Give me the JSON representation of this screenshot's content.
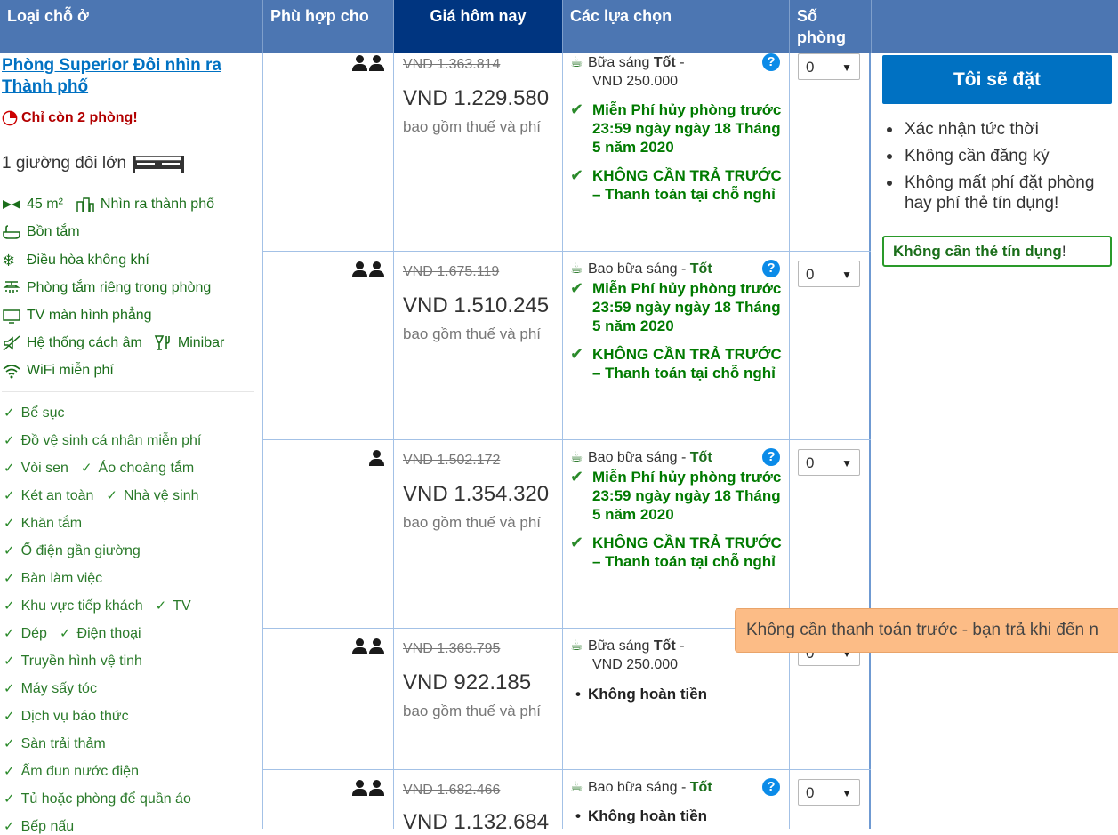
{
  "header": {
    "col_room_type": "Loại chỗ ở",
    "col_fits": "Phù hợp cho",
    "col_price": "Giá hôm nay",
    "col_options": "Các lựa chọn",
    "col_rooms": "Số phòng"
  },
  "room": {
    "name": "Phòng Superior Đôi nhìn ra Thành phố",
    "scarcity": "Chỉ còn 2 phòng!",
    "bed": "1 giường đôi lớn",
    "facilities": {
      "size": "45 m²",
      "view": "Nhìn ra thành phố",
      "bathtub": "Bồn tắm",
      "ac": "Điều hòa không khí",
      "private_bath": "Phòng tắm riêng trong phòng",
      "tv": "TV màn hình phẳng",
      "soundproof": "Hệ thống cách âm",
      "minibar": "Minibar",
      "wifi": "WiFi miễn phí"
    },
    "amenities": [
      [
        "Bể sục"
      ],
      [
        "Đồ vệ sinh cá nhân miễn phí"
      ],
      [
        "Vòi sen",
        "Áo choàng tắm"
      ],
      [
        "Két an toàn",
        "Nhà vệ sinh"
      ],
      [
        "Khăn tắm"
      ],
      [
        "Ổ điện gần giường"
      ],
      [
        "Bàn làm việc"
      ],
      [
        "Khu vực tiếp khách",
        "TV"
      ],
      [
        "Dép",
        "Điện thoại"
      ],
      [
        "Truyền hình vệ tinh"
      ],
      [
        "Máy sấy tóc"
      ],
      [
        "Dịch vụ báo thức"
      ],
      [
        "Sàn trải thảm"
      ],
      [
        "Ấm đun nước điện"
      ],
      [
        "Tủ hoặc phòng để quần áo"
      ],
      [
        "Bếp nấu"
      ]
    ]
  },
  "common": {
    "price_note": "bao gồm thuế và phí",
    "cancel": "Miễn Phí hủy phòng trước 23:59 ngày ngày 18 Tháng 5 năm 2020",
    "no_prepay": "KHÔNG CẦN TRẢ TRƯỚC – Thanh toán tại chỗ nghỉ",
    "non_refundable": "Không hoàn tiền",
    "qty_value": "0"
  },
  "rows": [
    {
      "guests": 2,
      "old_price": "VND 1.363.814",
      "new_price": "VND 1.229.580",
      "bf_label": "Bữa sáng",
      "bf_quality": "Tốt",
      "bf_price": "VND 250.000"
    },
    {
      "guests": 2,
      "old_price": "VND 1.675.119",
      "new_price": "VND 1.510.245",
      "bf_label": "Bao bữa sáng",
      "bf_quality": "Tốt"
    },
    {
      "guests": 1,
      "old_price": "VND 1.502.172",
      "new_price": "VND 1.354.320",
      "bf_label": "Bao bữa sáng",
      "bf_quality": "Tốt"
    },
    {
      "guests": 2,
      "old_price": "VND 1.369.795",
      "new_price": "VND 922.185",
      "bf_label": "Bữa sáng",
      "bf_quality": "Tốt",
      "bf_price": "VND 250.000"
    },
    {
      "guests": 2,
      "old_price": "VND 1.682.466",
      "new_price": "VND 1.132.684",
      "bf_label": "Bao bữa sáng",
      "bf_quality": "Tốt"
    }
  ],
  "sidebar": {
    "book_button": "Tôi sẽ đặt",
    "perks": [
      "Xác nhận tức thời",
      "Không cần đăng ký",
      "Không mất phí đặt phòng hay phí thẻ tín dụng!"
    ],
    "no_card": "Không cần thẻ tín dụng",
    "no_card_suffix": "!"
  },
  "tooltip": "Không cần thanh toán trước - bạn trả khi đến n",
  "colors": {
    "header_bg": "#4c76b2",
    "price_header_bg": "#003580",
    "button_bg": "#0071c2",
    "green": "#007a00",
    "scarcity": "#b20000",
    "tooltip_bg": "#fcbc86"
  }
}
